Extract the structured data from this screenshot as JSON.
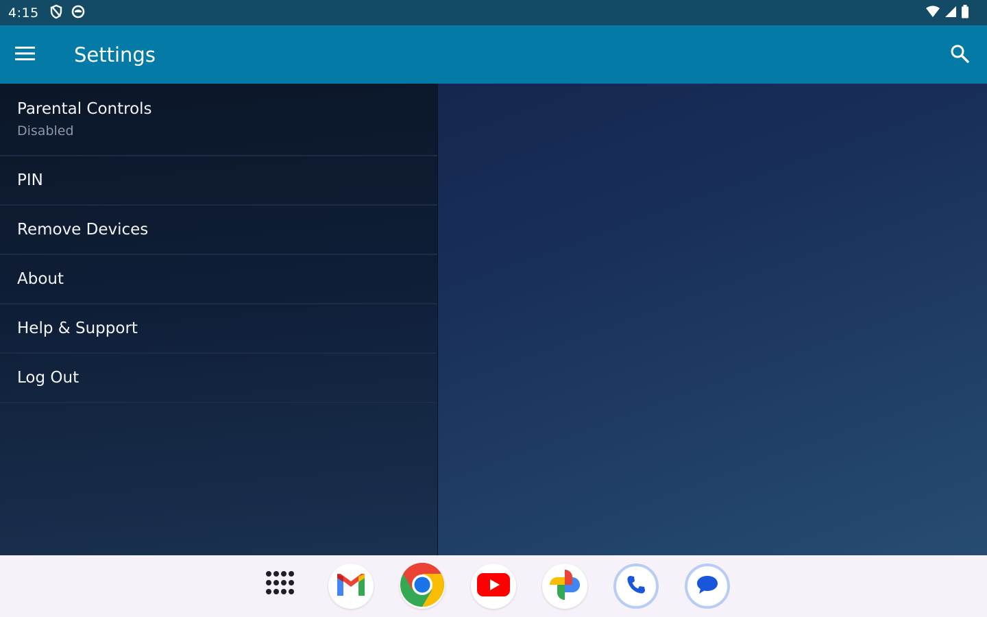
{
  "status_bar": {
    "time": "4:15",
    "left_icons": [
      "vpn-shield-icon",
      "data-saver-icon"
    ],
    "right_icons": [
      "wifi-icon",
      "signal-icon",
      "battery-icon"
    ]
  },
  "app_bar": {
    "title": "Settings",
    "menu_icon": "hamburger-menu-icon",
    "search_icon": "search-icon",
    "color": "#047aa7"
  },
  "settings": {
    "items": [
      {
        "title": "Parental Controls",
        "subtitle": "Disabled"
      },
      {
        "title": "PIN"
      },
      {
        "title": "Remove Devices"
      },
      {
        "title": "About"
      },
      {
        "title": "Help & Support"
      },
      {
        "title": "Log Out"
      }
    ]
  },
  "dock": {
    "apps": [
      "app-drawer-icon",
      "gmail-icon",
      "chrome-icon",
      "youtube-icon",
      "photos-icon",
      "phone-icon",
      "messages-icon"
    ]
  }
}
